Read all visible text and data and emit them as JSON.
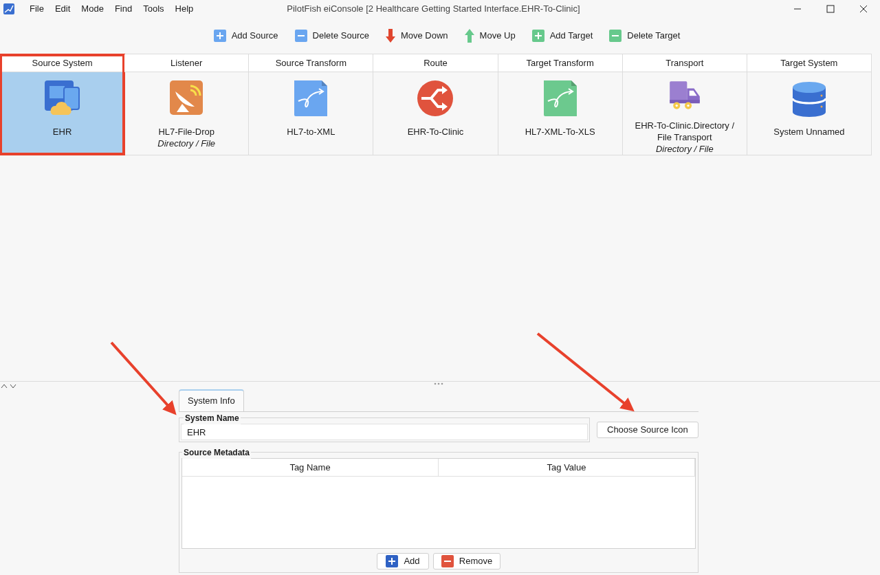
{
  "window": {
    "title": "PilotFish eiConsole [2 Healthcare Getting Started Interface.EHR-To-Clinic]"
  },
  "menu": [
    "File",
    "Edit",
    "Mode",
    "Find",
    "Tools",
    "Help"
  ],
  "toolbar": [
    {
      "label": "Add Source",
      "kind": "plus",
      "color": "#6aa6f0"
    },
    {
      "label": "Delete Source",
      "kind": "minus",
      "color": "#6aa6f0"
    },
    {
      "label": "Move Down",
      "kind": "down",
      "color": "#e0452e"
    },
    {
      "label": "Move Up",
      "kind": "up",
      "color": "#67c98c"
    },
    {
      "label": "Add Target",
      "kind": "plus",
      "color": "#67c98c"
    },
    {
      "label": "Delete Target",
      "kind": "minus",
      "color": "#67c98c"
    }
  ],
  "stages": [
    {
      "header": "Source System",
      "kind": "system",
      "name": "EHR",
      "selected": true
    },
    {
      "header": "Listener",
      "kind": "listener",
      "name": "HL7-File-Drop",
      "subtitle": "Directory / File",
      "selected": false
    },
    {
      "header": "Source Transform",
      "kind": "transform",
      "color": "#6aa6f0",
      "name": "HL7-to-XML",
      "selected": false
    },
    {
      "header": "Route",
      "kind": "route",
      "name": "EHR-To-Clinic",
      "selected": false
    },
    {
      "header": "Target Transform",
      "kind": "transform",
      "color": "#6cc98e",
      "name": "HL7-XML-To-XLS",
      "selected": false
    },
    {
      "header": "Transport",
      "kind": "transport",
      "name": "EHR-To-Clinic.Directory / File Transport",
      "subtitle": "Directory / File",
      "selected": false
    },
    {
      "header": "Target System",
      "kind": "database",
      "name": "System Unnamed",
      "selected": false
    }
  ],
  "panel": {
    "tabs": [
      {
        "label": "System Info",
        "selected": true
      }
    ],
    "system_name": {
      "label": "System Name",
      "value": "EHR"
    },
    "choose_button": "Choose Source Icon",
    "metadata": {
      "title": "Source Metadata",
      "columns": [
        "Tag Name",
        "Tag Value"
      ]
    },
    "buttons": [
      {
        "label": "Add",
        "kind": "plus",
        "color": "#2f62c4"
      },
      {
        "label": "Remove",
        "kind": "minus",
        "color": "#e0533d"
      }
    ]
  }
}
